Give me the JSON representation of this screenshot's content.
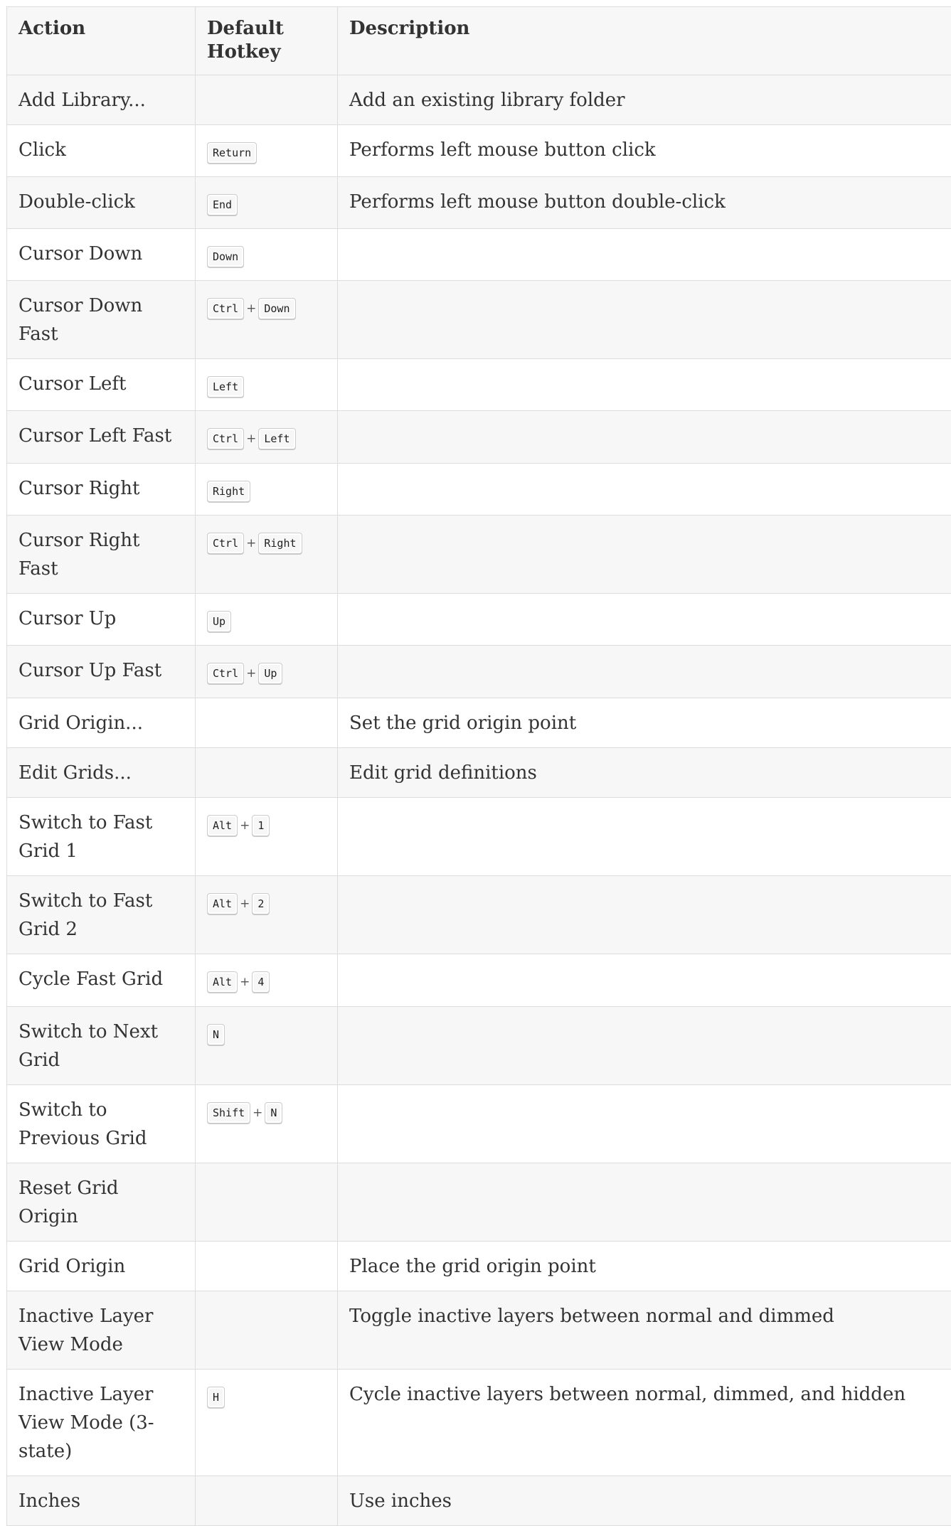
{
  "table": {
    "headers": [
      "Action",
      "Default Hotkey",
      "Description"
    ],
    "rows": [
      {
        "action": "Add Library...",
        "keys": [],
        "description": "Add an existing library folder"
      },
      {
        "action": "Click",
        "keys": [
          "Return"
        ],
        "description": "Performs left mouse button click"
      },
      {
        "action": "Double-click",
        "keys": [
          "End"
        ],
        "description": "Performs left mouse button double-click"
      },
      {
        "action": "Cursor Down",
        "keys": [
          "Down"
        ],
        "description": ""
      },
      {
        "action": "Cursor Down Fast",
        "keys": [
          "Ctrl",
          "Down"
        ],
        "description": ""
      },
      {
        "action": "Cursor Left",
        "keys": [
          "Left"
        ],
        "description": ""
      },
      {
        "action": "Cursor Left Fast",
        "keys": [
          "Ctrl",
          "Left"
        ],
        "description": ""
      },
      {
        "action": "Cursor Right",
        "keys": [
          "Right"
        ],
        "description": ""
      },
      {
        "action": "Cursor Right Fast",
        "keys": [
          "Ctrl",
          "Right"
        ],
        "description": ""
      },
      {
        "action": "Cursor Up",
        "keys": [
          "Up"
        ],
        "description": ""
      },
      {
        "action": "Cursor Up Fast",
        "keys": [
          "Ctrl",
          "Up"
        ],
        "description": ""
      },
      {
        "action": "Grid Origin...",
        "keys": [],
        "description": "Set the grid origin point"
      },
      {
        "action": "Edit Grids...",
        "keys": [],
        "description": "Edit grid definitions"
      },
      {
        "action": "Switch to Fast Grid 1",
        "keys": [
          "Alt",
          "1"
        ],
        "description": ""
      },
      {
        "action": "Switch to Fast Grid 2",
        "keys": [
          "Alt",
          "2"
        ],
        "description": ""
      },
      {
        "action": "Cycle Fast Grid",
        "keys": [
          "Alt",
          "4"
        ],
        "description": ""
      },
      {
        "action": "Switch to Next Grid",
        "keys": [
          "N"
        ],
        "description": ""
      },
      {
        "action": "Switch to Previous Grid",
        "keys": [
          "Shift",
          "N"
        ],
        "description": ""
      },
      {
        "action": "Reset Grid Origin",
        "keys": [],
        "description": ""
      },
      {
        "action": "Grid Origin",
        "keys": [],
        "description": "Place the grid origin point"
      },
      {
        "action": "Inactive Layer View Mode",
        "keys": [],
        "description": "Toggle inactive layers between normal and dimmed"
      },
      {
        "action": "Inactive Layer View Mode (3-state)",
        "keys": [
          "H"
        ],
        "description": "Cycle inactive layers between normal, dimmed, and hidden"
      },
      {
        "action": "Inches",
        "keys": [],
        "description": "Use inches"
      }
    ],
    "key_separator": "+"
  }
}
